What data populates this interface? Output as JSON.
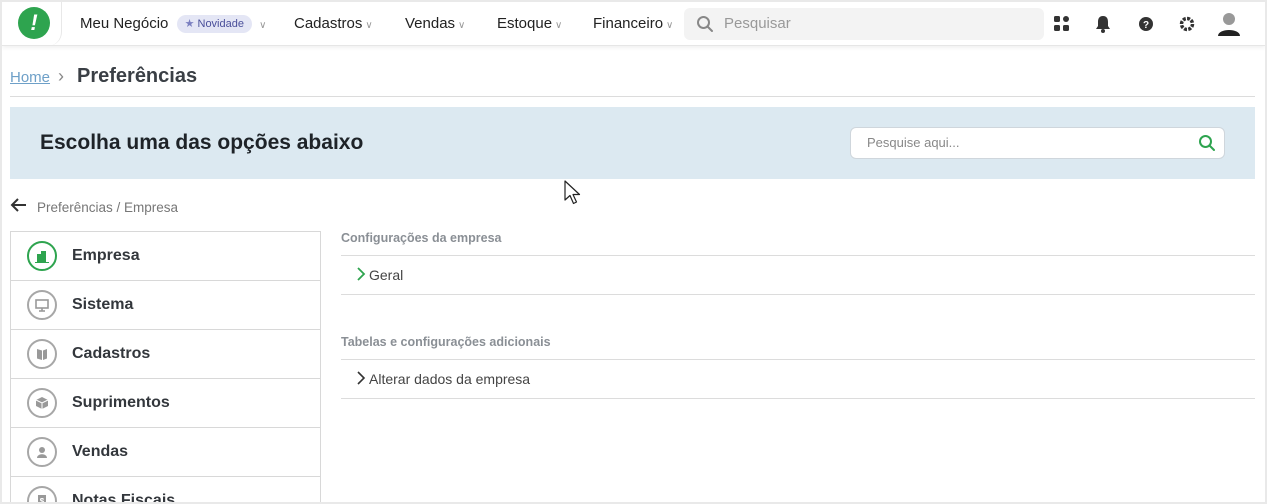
{
  "topbar": {
    "logo_char": "!",
    "nav": [
      {
        "label": "Meu Negócio",
        "badge": "Novidade"
      },
      {
        "label": "Cadastros"
      },
      {
        "label": "Vendas"
      },
      {
        "label": "Estoque"
      },
      {
        "label": "Financeiro"
      }
    ],
    "search_placeholder": "Pesquisar",
    "icons": [
      "apps-icon",
      "bell-icon",
      "help-icon",
      "gear-icon",
      "user-avatar-icon"
    ]
  },
  "breadcrumb": {
    "home": "Home",
    "current": "Preferências"
  },
  "banner": {
    "title": "Escolha uma das opções abaixo",
    "search_placeholder": "Pesquise aqui..."
  },
  "back": {
    "path": "Preferências / Empresa"
  },
  "sidebar": {
    "items": [
      {
        "label": "Empresa",
        "icon": "building-icon"
      },
      {
        "label": "Sistema",
        "icon": "monitor-icon"
      },
      {
        "label": "Cadastros",
        "icon": "book-icon"
      },
      {
        "label": "Suprimentos",
        "icon": "box-icon"
      },
      {
        "label": "Vendas",
        "icon": "handshake-icon"
      },
      {
        "label": "Notas Fiscais",
        "icon": "receipt-icon"
      }
    ]
  },
  "sections": [
    {
      "title": "Configurações da empresa",
      "items": [
        "Geral"
      ]
    },
    {
      "title": "Tabelas e configurações adicionais",
      "items": [
        "Alterar dados da empresa"
      ]
    }
  ],
  "colors": {
    "brand": "#2ea44f",
    "banner_bg": "#dce9f1",
    "link": "#6ea0c8"
  }
}
